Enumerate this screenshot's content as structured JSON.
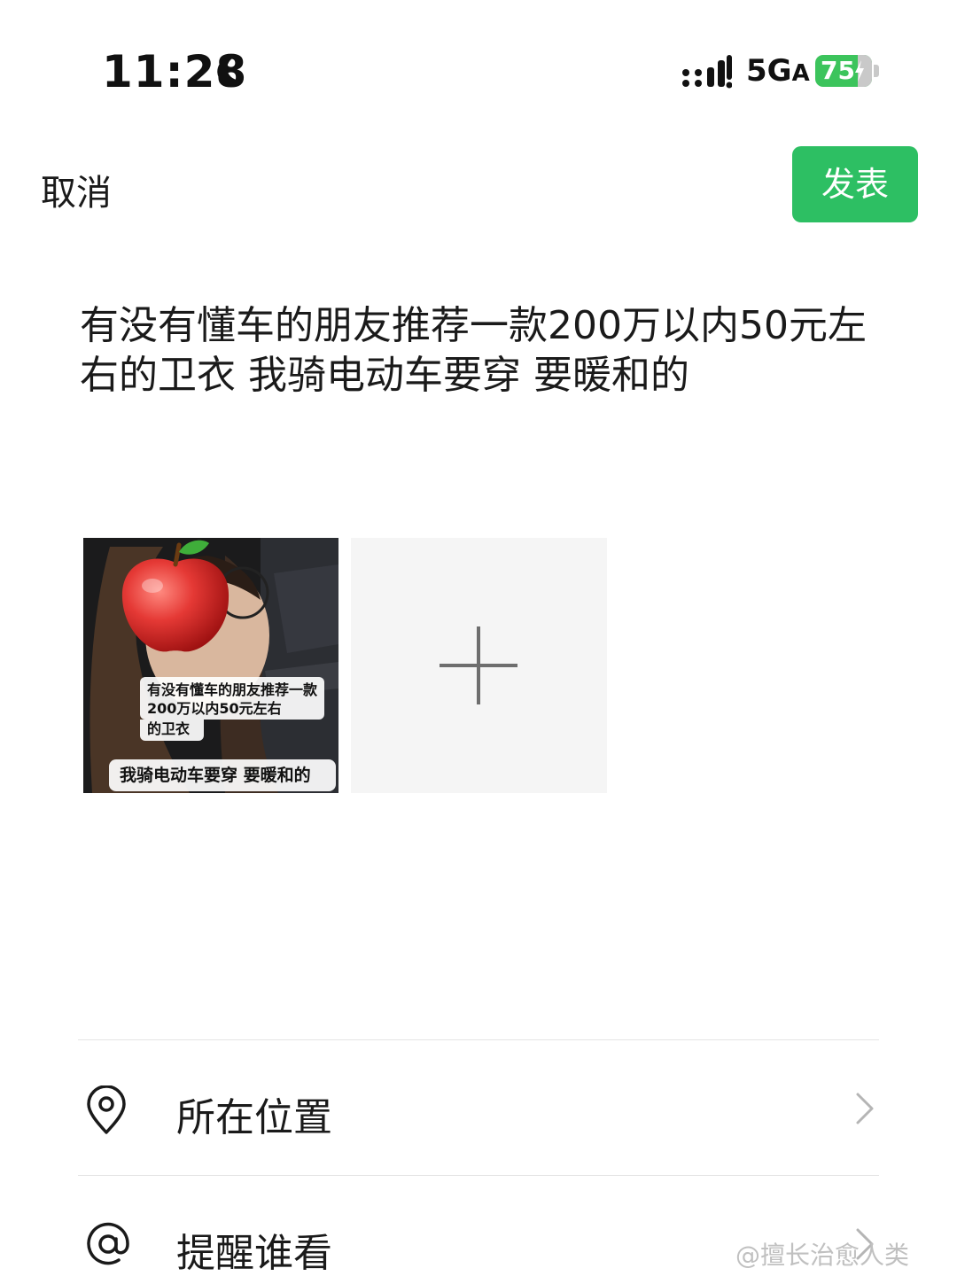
{
  "status_bar": {
    "time": "11:28",
    "network": "5G",
    "network_suffix": "A",
    "battery": "75"
  },
  "header": {
    "cancel_label": "取消",
    "publish_label": "发表"
  },
  "post": {
    "text": "有没有懂车的朋友推荐一款200万以内50元左右的卫衣 我骑电动车要穿 要暖和的"
  },
  "media": {
    "caption_1": "有没有懂车的朋友推荐一款200万以内50元左右",
    "caption_1_tail": "的卫衣",
    "caption_2": "我骑电动车要穿 要暖和的"
  },
  "options": {
    "location_label": "所在位置",
    "remind_label": "提醒谁看"
  },
  "watermark": "@擅长治愈人类",
  "colors": {
    "accent": "#2dbf63",
    "battery": "#3cc45c"
  },
  "icons": [
    "moon-icon",
    "signal-icon",
    "battery-icon",
    "plus-icon",
    "location-pin-icon",
    "at-icon",
    "chevron-right-icon"
  ]
}
